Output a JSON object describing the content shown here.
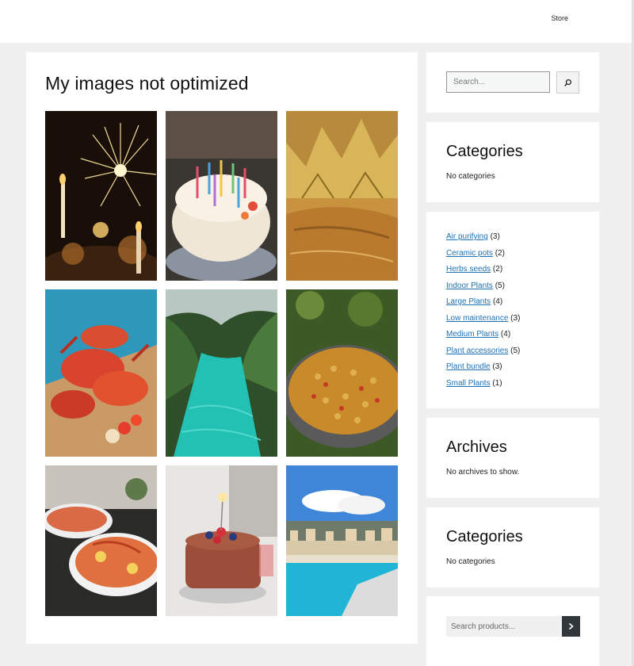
{
  "header": {
    "nav": [
      {
        "label": "Store"
      }
    ]
  },
  "main": {
    "title": "My images not optimized",
    "images": [
      {
        "subject": "sparkler-candles"
      },
      {
        "subject": "birthday-cake-candles"
      },
      {
        "subject": "galette-des-rois-crown"
      },
      {
        "subject": "seafood-crabs-platter"
      },
      {
        "subject": "river-gorge-turquoise"
      },
      {
        "subject": "paella-pan"
      },
      {
        "subject": "seafood-platters-table"
      },
      {
        "subject": "chocolate-cake-berries-sparkler"
      },
      {
        "subject": "nice-beach-promenade"
      }
    ]
  },
  "sidebar": {
    "search": {
      "placeholder": "Search..."
    },
    "categories_1": {
      "title": "Categories",
      "empty_text": "No categories"
    },
    "product_categories": {
      "items": [
        {
          "label": "Air purifying",
          "count": "(3)"
        },
        {
          "label": "Ceramic pots",
          "count": "(2)"
        },
        {
          "label": "Herbs seeds",
          "count": "(2)"
        },
        {
          "label": "Indoor Plants",
          "count": "(5)"
        },
        {
          "label": "Large Plants",
          "count": "(4)"
        },
        {
          "label": "Low maintenance",
          "count": "(3)"
        },
        {
          "label": "Medium Plants",
          "count": "(4)"
        },
        {
          "label": "Plant accessories",
          "count": "(5)"
        },
        {
          "label": "Plant bundle",
          "count": "(3)"
        },
        {
          "label": "Small Plants",
          "count": "(1)"
        }
      ]
    },
    "archives": {
      "title": "Archives",
      "empty_text": "No archives to show."
    },
    "categories_2": {
      "title": "Categories",
      "empty_text": "No categories"
    },
    "product_search": {
      "placeholder": "Search products..."
    }
  },
  "colors": {
    "page_bg": "#f0f0f1",
    "card_bg": "#ffffff",
    "link": "#2271b1",
    "button_dark": "#32373c"
  }
}
